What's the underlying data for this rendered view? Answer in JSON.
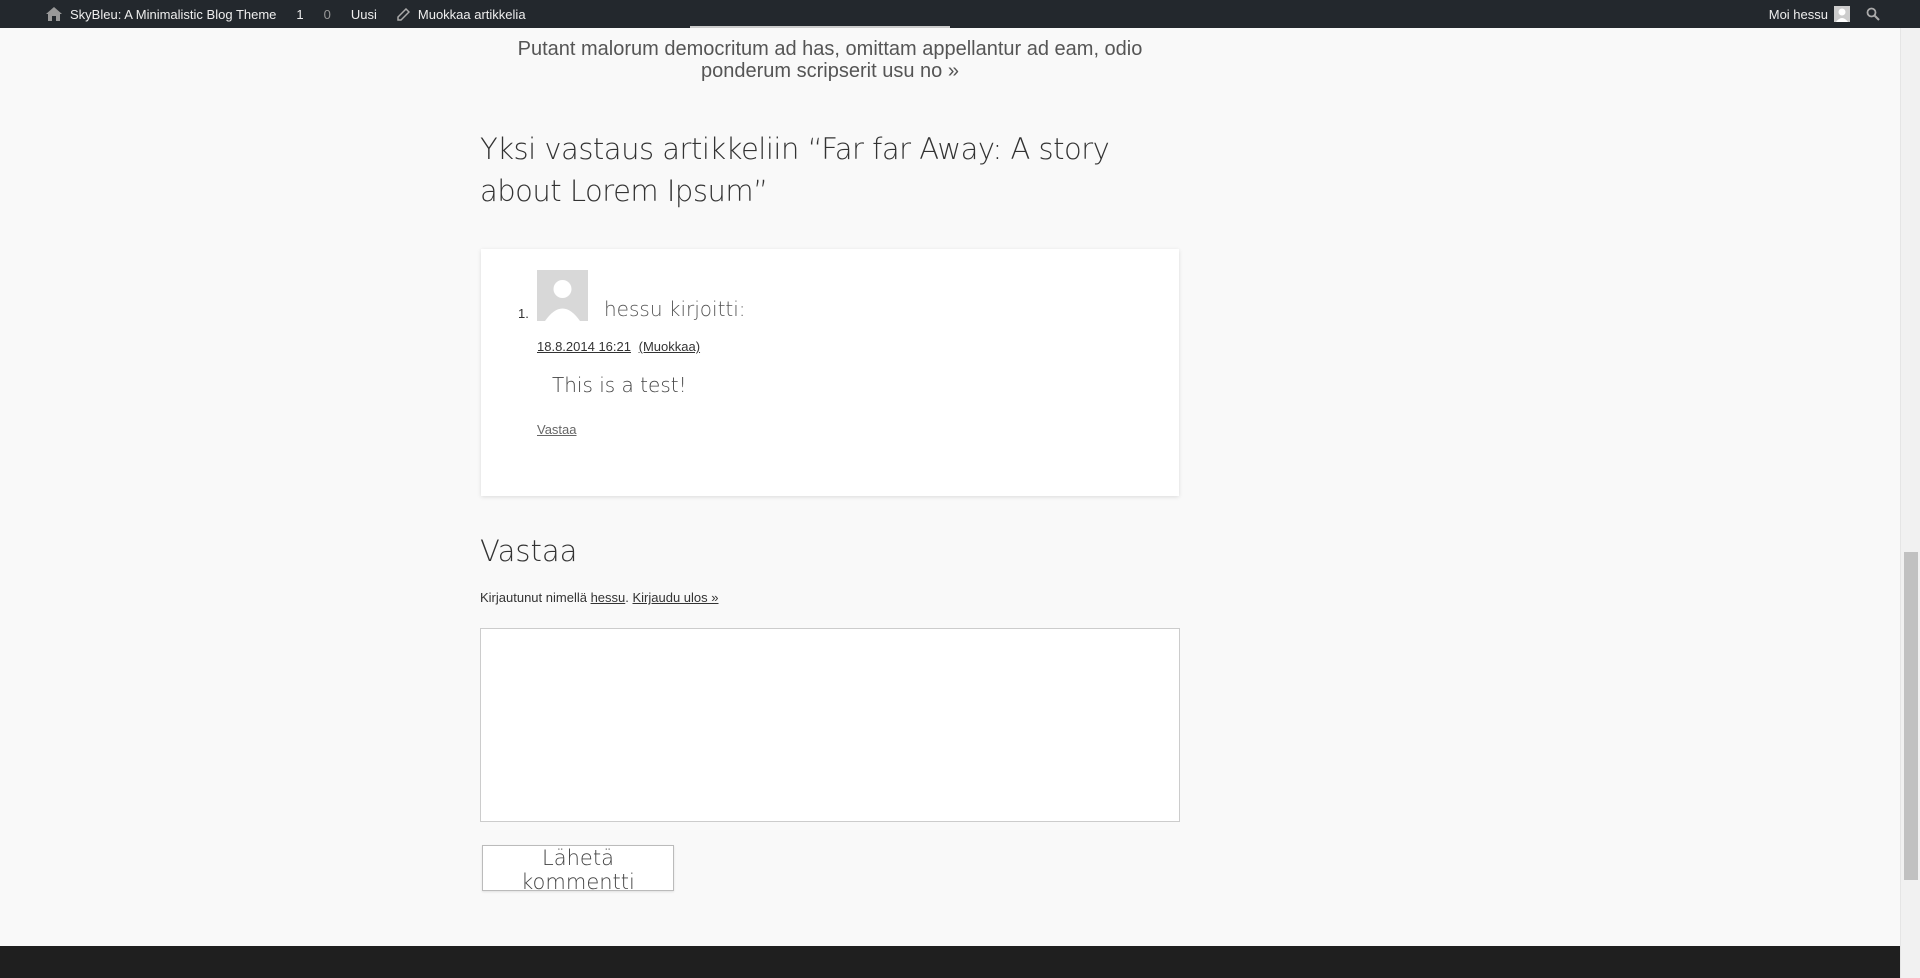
{
  "adminbar": {
    "site_name": "SkyBleu: A Minimalistic Blog Theme",
    "updates_count": "1",
    "comments_count": "0",
    "new_label": "Uusi",
    "edit_label": "Muokkaa artikkelia",
    "greeting": "Moi hessu"
  },
  "post": {
    "excerpt_line1": "Putant malorum democritum ad has, omittam appellantur ad eam, odio",
    "excerpt_line2": "ponderum scripserit usu no »"
  },
  "comments": {
    "title": "Yksi vastaus artikkeliin “Far far Away: A story about Lorem Ipsum”",
    "items": [
      {
        "number": "1.",
        "author": "hessu",
        "says": "kirjoitti:",
        "date": "18.8.2014 16:21",
        "edit": "(Muokkaa)",
        "text": "This is a test!",
        "reply": "Vastaa"
      }
    ]
  },
  "respond": {
    "title": "Vastaa",
    "logged_prefix": "Kirjautunut nimellä ",
    "logged_user": "hessu",
    "logged_sep": ". ",
    "logout": "Kirjaudu ulos »",
    "textarea_value": "",
    "submit_label": "Lähetä kommentti"
  },
  "colors": {
    "adminbar_bg": "#23282d",
    "page_bg": "#f9f9f9",
    "footer_bg": "#1f1f1f"
  }
}
